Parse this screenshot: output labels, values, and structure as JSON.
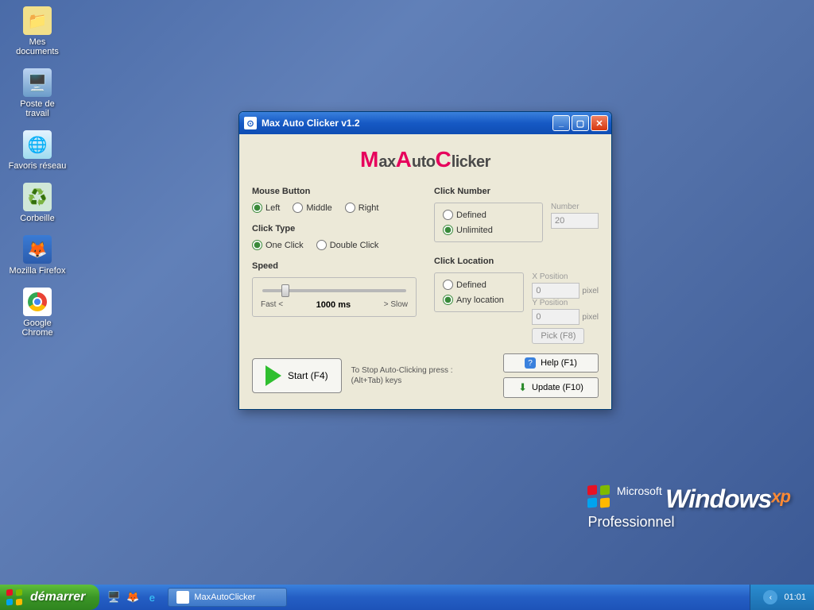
{
  "desktop": {
    "icons": [
      {
        "label": "Mes documents"
      },
      {
        "label": "Poste de travail"
      },
      {
        "label": "Favoris réseau"
      },
      {
        "label": "Corbeille"
      },
      {
        "label": "Mozilla Firefox"
      },
      {
        "label": "Google Chrome"
      }
    ],
    "wallpaper": {
      "brand": "Windows",
      "tag": "xp",
      "edition": "Professionnel",
      "company": "Microsoft"
    }
  },
  "window": {
    "title": "Max Auto Clicker v1.2",
    "logo": {
      "m": "M",
      "ax": "ax",
      "a": "A",
      "uto": "uto",
      "c": "C",
      "licker": "licker"
    },
    "mouseButton": {
      "title": "Mouse Button",
      "options": [
        "Left",
        "Middle",
        "Right"
      ],
      "selected": "Left"
    },
    "clickType": {
      "title": "Click Type",
      "options": [
        "One Click",
        "Double Click"
      ],
      "selected": "One Click"
    },
    "speed": {
      "title": "Speed",
      "fast": "Fast <",
      "value": "1000 ms",
      "slow": "> Slow"
    },
    "clickNumber": {
      "title": "Click Number",
      "options": [
        "Defined",
        "Unlimited"
      ],
      "selected": "Unlimited",
      "numberLabel": "Number",
      "numberValue": "20"
    },
    "clickLocation": {
      "title": "Click Location",
      "options": [
        "Defined",
        "Any location"
      ],
      "selected": "Any location",
      "xLabel": "X Position",
      "xValue": "0",
      "yLabel": "Y Position",
      "yValue": "0",
      "unit": "pixel",
      "pickLabel": "Pick (F8)"
    },
    "start": {
      "label": "Start (F4)"
    },
    "stopHint": {
      "line1": "To Stop Auto-Clicking press :",
      "line2": "(Alt+Tab) keys"
    },
    "help": {
      "label": "Help (F1)"
    },
    "update": {
      "label": "Update (F10)"
    }
  },
  "taskbar": {
    "start": "démarrer",
    "app": "MaxAutoClicker",
    "clock": "01:01"
  }
}
